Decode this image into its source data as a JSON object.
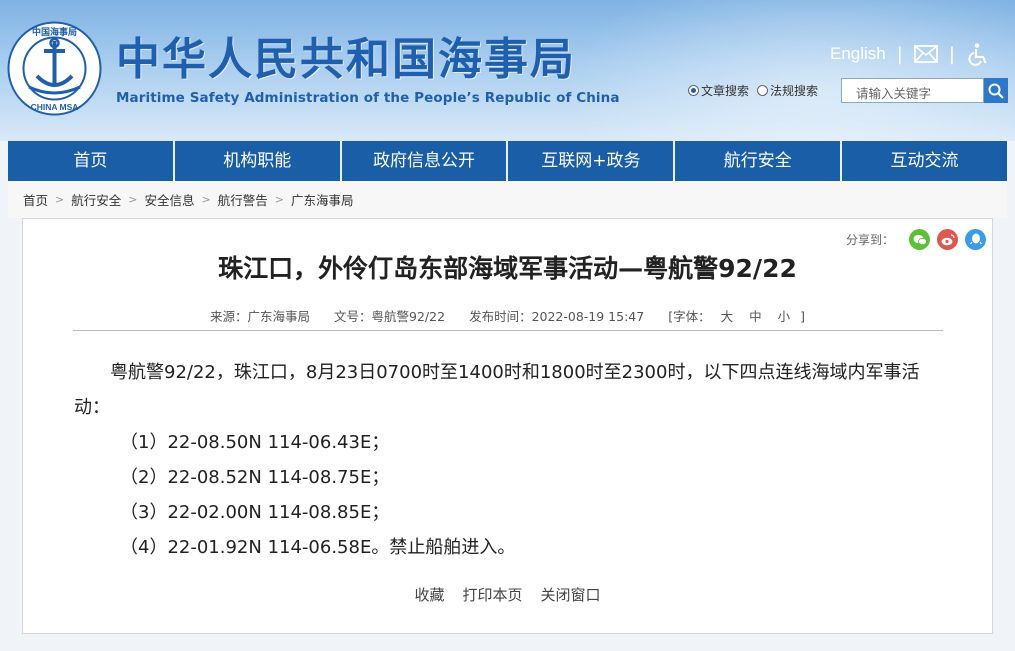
{
  "header": {
    "title": "中华人民共和国海事局",
    "subtitle": "Maritime Safety Administration of the People’s Republic of China",
    "logo_text_top": "中国海事局",
    "logo_text_bottom": "CHINA MSA",
    "english_link": "English",
    "search_options": [
      "文章搜索",
      "法规搜索"
    ],
    "search_placeholder": "请输入关键字"
  },
  "nav": [
    "首页",
    "机构职能",
    "政府信息公开",
    "互联网+政务",
    "航行安全",
    "互动交流"
  ],
  "breadcrumb": [
    "首页",
    "航行安全",
    "安全信息",
    "航行警告",
    "广东海事局"
  ],
  "article": {
    "share_label": "分享到：",
    "title": "珠江口，外伶仃岛东部海域军事活动—粤航警92/22",
    "source": "来源：广东海事局",
    "doc_no": "文号：粤航警92/22",
    "published": "发布时间：2022-08-19 15:47",
    "font_label": "[字体：",
    "font_sizes": [
      "大",
      "中",
      "小"
    ],
    "font_close": "]",
    "paragraph": "粤航警92/22，珠江口，8月23日0700时至1400时和1800时至2300时，以下四点连线海域内军事活动：",
    "coordinates": [
      "（1）22-08.50N 114-06.43E；",
      "（2）22-08.52N 114-08.75E；",
      "（3）22-02.00N 114-08.85E；",
      "（4）22-01.92N 114-06.58E。禁止船舶进入。"
    ],
    "actions": [
      "收藏",
      "打印本页",
      "关闭窗口"
    ]
  },
  "colors": {
    "brand": "#1b5ea8",
    "title_blue": "#1f5fae",
    "wechat": "#5fbf3a",
    "weibo": "#e0574f",
    "qq": "#3a9be8"
  },
  "icons": [
    "mail-icon",
    "accessibility-icon",
    "search-icon",
    "wechat-icon",
    "weibo-icon",
    "qq-icon"
  ]
}
